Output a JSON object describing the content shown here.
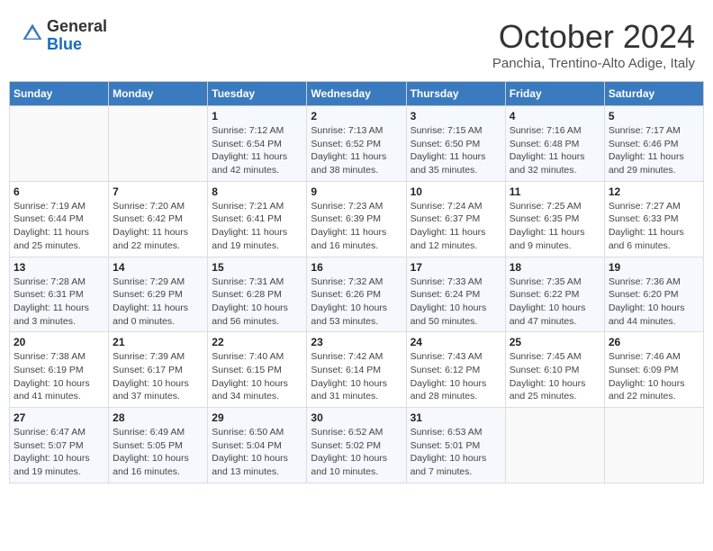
{
  "header": {
    "logo_general": "General",
    "logo_blue": "Blue",
    "month_title": "October 2024",
    "location": "Panchia, Trentino-Alto Adige, Italy"
  },
  "days_of_week": [
    "Sunday",
    "Monday",
    "Tuesday",
    "Wednesday",
    "Thursday",
    "Friday",
    "Saturday"
  ],
  "weeks": [
    [
      {
        "day": "",
        "info": ""
      },
      {
        "day": "",
        "info": ""
      },
      {
        "day": "1",
        "sunrise": "Sunrise: 7:12 AM",
        "sunset": "Sunset: 6:54 PM",
        "daylight": "Daylight: 11 hours and 42 minutes."
      },
      {
        "day": "2",
        "sunrise": "Sunrise: 7:13 AM",
        "sunset": "Sunset: 6:52 PM",
        "daylight": "Daylight: 11 hours and 38 minutes."
      },
      {
        "day": "3",
        "sunrise": "Sunrise: 7:15 AM",
        "sunset": "Sunset: 6:50 PM",
        "daylight": "Daylight: 11 hours and 35 minutes."
      },
      {
        "day": "4",
        "sunrise": "Sunrise: 7:16 AM",
        "sunset": "Sunset: 6:48 PM",
        "daylight": "Daylight: 11 hours and 32 minutes."
      },
      {
        "day": "5",
        "sunrise": "Sunrise: 7:17 AM",
        "sunset": "Sunset: 6:46 PM",
        "daylight": "Daylight: 11 hours and 29 minutes."
      }
    ],
    [
      {
        "day": "6",
        "sunrise": "Sunrise: 7:19 AM",
        "sunset": "Sunset: 6:44 PM",
        "daylight": "Daylight: 11 hours and 25 minutes."
      },
      {
        "day": "7",
        "sunrise": "Sunrise: 7:20 AM",
        "sunset": "Sunset: 6:42 PM",
        "daylight": "Daylight: 11 hours and 22 minutes."
      },
      {
        "day": "8",
        "sunrise": "Sunrise: 7:21 AM",
        "sunset": "Sunset: 6:41 PM",
        "daylight": "Daylight: 11 hours and 19 minutes."
      },
      {
        "day": "9",
        "sunrise": "Sunrise: 7:23 AM",
        "sunset": "Sunset: 6:39 PM",
        "daylight": "Daylight: 11 hours and 16 minutes."
      },
      {
        "day": "10",
        "sunrise": "Sunrise: 7:24 AM",
        "sunset": "Sunset: 6:37 PM",
        "daylight": "Daylight: 11 hours and 12 minutes."
      },
      {
        "day": "11",
        "sunrise": "Sunrise: 7:25 AM",
        "sunset": "Sunset: 6:35 PM",
        "daylight": "Daylight: 11 hours and 9 minutes."
      },
      {
        "day": "12",
        "sunrise": "Sunrise: 7:27 AM",
        "sunset": "Sunset: 6:33 PM",
        "daylight": "Daylight: 11 hours and 6 minutes."
      }
    ],
    [
      {
        "day": "13",
        "sunrise": "Sunrise: 7:28 AM",
        "sunset": "Sunset: 6:31 PM",
        "daylight": "Daylight: 11 hours and 3 minutes."
      },
      {
        "day": "14",
        "sunrise": "Sunrise: 7:29 AM",
        "sunset": "Sunset: 6:29 PM",
        "daylight": "Daylight: 11 hours and 0 minutes."
      },
      {
        "day": "15",
        "sunrise": "Sunrise: 7:31 AM",
        "sunset": "Sunset: 6:28 PM",
        "daylight": "Daylight: 10 hours and 56 minutes."
      },
      {
        "day": "16",
        "sunrise": "Sunrise: 7:32 AM",
        "sunset": "Sunset: 6:26 PM",
        "daylight": "Daylight: 10 hours and 53 minutes."
      },
      {
        "day": "17",
        "sunrise": "Sunrise: 7:33 AM",
        "sunset": "Sunset: 6:24 PM",
        "daylight": "Daylight: 10 hours and 50 minutes."
      },
      {
        "day": "18",
        "sunrise": "Sunrise: 7:35 AM",
        "sunset": "Sunset: 6:22 PM",
        "daylight": "Daylight: 10 hours and 47 minutes."
      },
      {
        "day": "19",
        "sunrise": "Sunrise: 7:36 AM",
        "sunset": "Sunset: 6:20 PM",
        "daylight": "Daylight: 10 hours and 44 minutes."
      }
    ],
    [
      {
        "day": "20",
        "sunrise": "Sunrise: 7:38 AM",
        "sunset": "Sunset: 6:19 PM",
        "daylight": "Daylight: 10 hours and 41 minutes."
      },
      {
        "day": "21",
        "sunrise": "Sunrise: 7:39 AM",
        "sunset": "Sunset: 6:17 PM",
        "daylight": "Daylight: 10 hours and 37 minutes."
      },
      {
        "day": "22",
        "sunrise": "Sunrise: 7:40 AM",
        "sunset": "Sunset: 6:15 PM",
        "daylight": "Daylight: 10 hours and 34 minutes."
      },
      {
        "day": "23",
        "sunrise": "Sunrise: 7:42 AM",
        "sunset": "Sunset: 6:14 PM",
        "daylight": "Daylight: 10 hours and 31 minutes."
      },
      {
        "day": "24",
        "sunrise": "Sunrise: 7:43 AM",
        "sunset": "Sunset: 6:12 PM",
        "daylight": "Daylight: 10 hours and 28 minutes."
      },
      {
        "day": "25",
        "sunrise": "Sunrise: 7:45 AM",
        "sunset": "Sunset: 6:10 PM",
        "daylight": "Daylight: 10 hours and 25 minutes."
      },
      {
        "day": "26",
        "sunrise": "Sunrise: 7:46 AM",
        "sunset": "Sunset: 6:09 PM",
        "daylight": "Daylight: 10 hours and 22 minutes."
      }
    ],
    [
      {
        "day": "27",
        "sunrise": "Sunrise: 6:47 AM",
        "sunset": "Sunset: 5:07 PM",
        "daylight": "Daylight: 10 hours and 19 minutes."
      },
      {
        "day": "28",
        "sunrise": "Sunrise: 6:49 AM",
        "sunset": "Sunset: 5:05 PM",
        "daylight": "Daylight: 10 hours and 16 minutes."
      },
      {
        "day": "29",
        "sunrise": "Sunrise: 6:50 AM",
        "sunset": "Sunset: 5:04 PM",
        "daylight": "Daylight: 10 hours and 13 minutes."
      },
      {
        "day": "30",
        "sunrise": "Sunrise: 6:52 AM",
        "sunset": "Sunset: 5:02 PM",
        "daylight": "Daylight: 10 hours and 10 minutes."
      },
      {
        "day": "31",
        "sunrise": "Sunrise: 6:53 AM",
        "sunset": "Sunset: 5:01 PM",
        "daylight": "Daylight: 10 hours and 7 minutes."
      },
      {
        "day": "",
        "info": ""
      },
      {
        "day": "",
        "info": ""
      }
    ]
  ]
}
